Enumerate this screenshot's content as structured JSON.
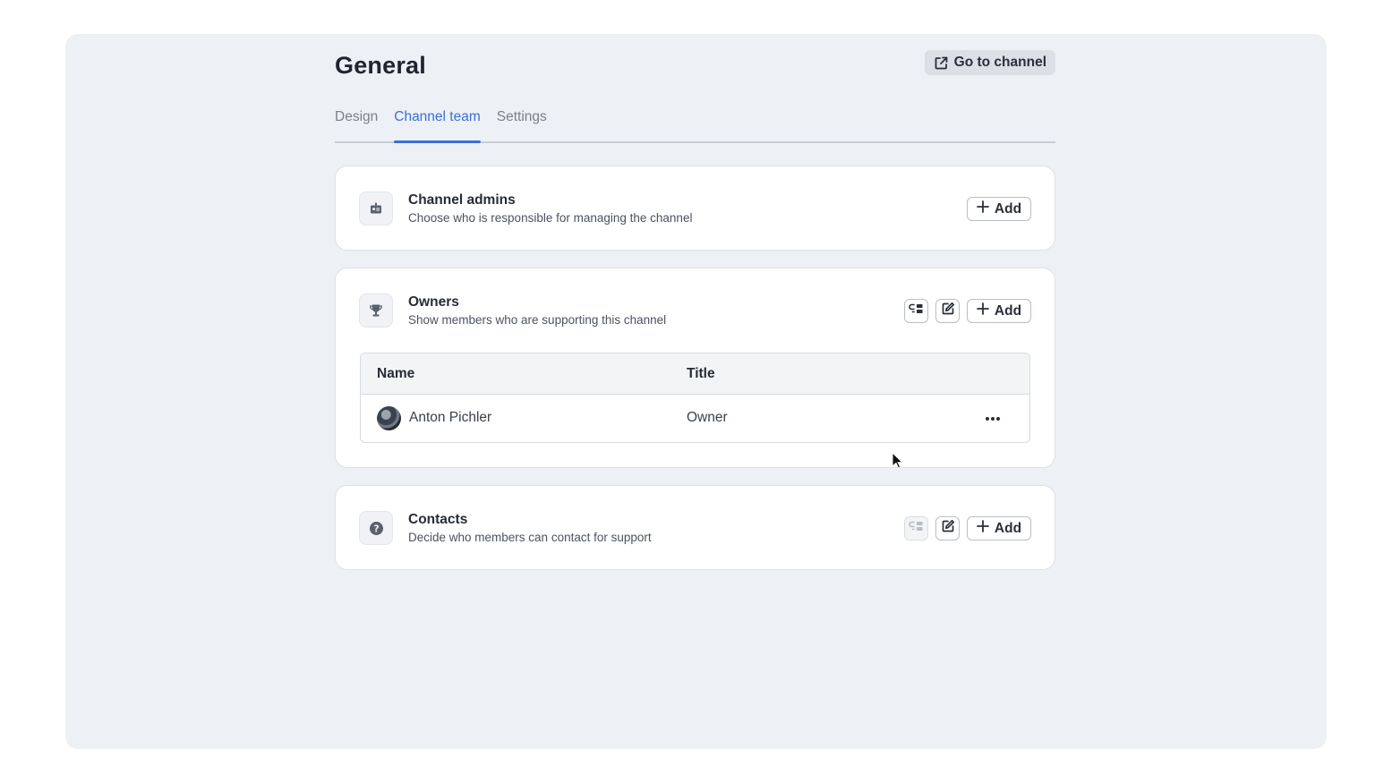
{
  "header": {
    "title": "General",
    "goto_label": "Go to channel"
  },
  "tabs": [
    {
      "label": "Design",
      "active": false
    },
    {
      "label": "Channel team",
      "active": true
    },
    {
      "label": "Settings",
      "active": false
    }
  ],
  "sections": {
    "admins": {
      "title": "Channel admins",
      "description": "Choose who is responsible for managing the channel",
      "icon": "id-badge-icon",
      "add_label": "Add"
    },
    "owners": {
      "title": "Owners",
      "description": "Show members who are supporting this channel",
      "icon": "trophy-icon",
      "add_label": "Add",
      "table": {
        "columns": [
          "Name",
          "Title"
        ],
        "rows": [
          {
            "name": "Anton Pichler",
            "title": "Owner"
          }
        ]
      }
    },
    "contacts": {
      "title": "Contacts",
      "description": "Decide who members can contact for support",
      "icon": "question-circle-icon",
      "add_label": "Add"
    }
  },
  "colors": {
    "accent": "#3b6fd8",
    "background": "#edf0f4",
    "card": "#ffffff"
  }
}
